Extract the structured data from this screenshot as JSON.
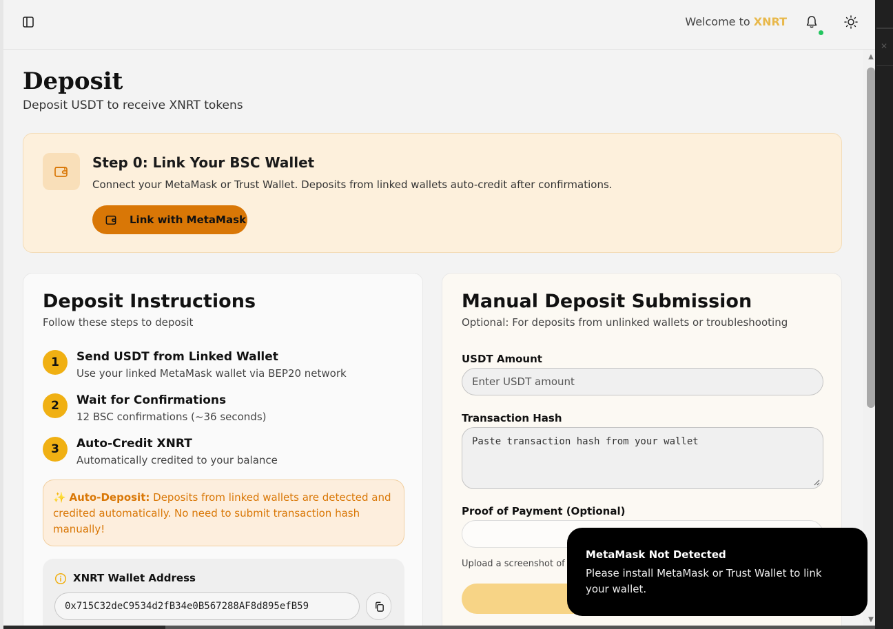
{
  "header": {
    "welcome_prefix": "Welcome to ",
    "brand": "XNRT"
  },
  "page": {
    "title": "Deposit",
    "subtitle": "Deposit USDT to receive XNRT tokens"
  },
  "step0": {
    "title": "Step 0: Link Your BSC Wallet",
    "description": "Connect your MetaMask or Trust Wallet. Deposits from linked wallets auto-credit after confirmations.",
    "button_label": "Link with MetaMask"
  },
  "instructions": {
    "title": "Deposit Instructions",
    "subtitle": "Follow these steps to deposit",
    "steps": [
      {
        "num": "1",
        "title": "Send USDT from Linked Wallet",
        "desc": "Use your linked MetaMask wallet via BEP20 network"
      },
      {
        "num": "2",
        "title": "Wait for Confirmations",
        "desc": "12 BSC confirmations (~36 seconds)"
      },
      {
        "num": "3",
        "title": "Auto-Credit XNRT",
        "desc": "Automatically credited to your balance"
      }
    ],
    "auto_deposit_label": "Auto-Deposit:",
    "auto_deposit_text": " Deposits from linked wallets are detected and credited automatically. No need to submit transaction hash manually!",
    "wallet_label": "XNRT Wallet Address",
    "wallet_address": "0x715C32deC9534d2fB34e0B567288AF8d895efB59"
  },
  "manual": {
    "title": "Manual Deposit Submission",
    "subtitle": "Optional: For deposits from unlinked wallets or troubleshooting",
    "amount_label": "USDT Amount",
    "amount_placeholder": "Enter USDT amount",
    "hash_label": "Transaction Hash",
    "hash_placeholder": "Paste transaction hash from your wallet",
    "proof_label": "Proof of Payment (Optional)",
    "upload_hint": "Upload a screenshot of"
  },
  "toast": {
    "title": "MetaMask Not Detected",
    "message": "Please install MetaMask or Trust Wallet to link your wallet."
  },
  "colors": {
    "accent": "#d97706",
    "step_badge": "#f0b013",
    "brand": "#e8b84a",
    "status_dot": "#22c55e"
  }
}
